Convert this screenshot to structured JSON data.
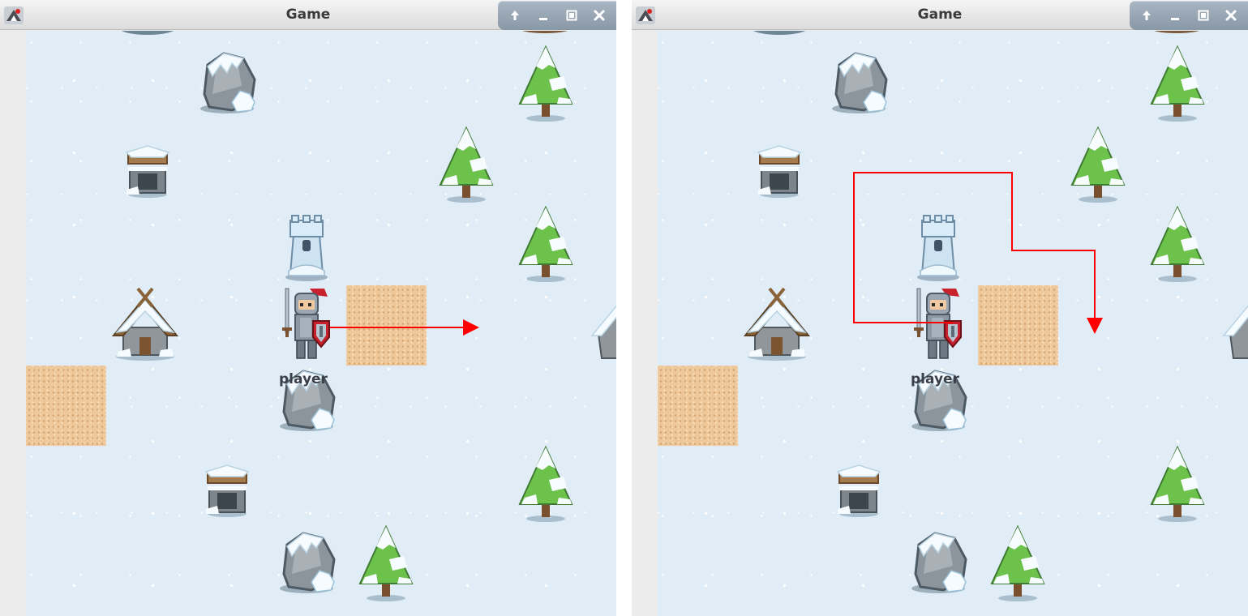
{
  "panels": [
    {
      "title": "Game",
      "player_label": "player",
      "path_color": "#ff0000",
      "icons": [
        "app-icon",
        "shade-up-icon",
        "minimize-icon",
        "maximize-icon",
        "close-icon"
      ]
    },
    {
      "title": "Game",
      "player_label": "player",
      "path_color": "#ff0000",
      "icons": [
        "app-icon",
        "shade-up-icon",
        "minimize-icon",
        "maximize-icon",
        "close-icon"
      ]
    }
  ],
  "scene": {
    "background": "#e0edf6",
    "sand_color": "#eec89a",
    "objects": [
      "snowy-rock",
      "snowy-pine-tree",
      "snowy-well",
      "ice-tower",
      "snowy-cabin",
      "knight-player",
      "sand-tile"
    ]
  }
}
